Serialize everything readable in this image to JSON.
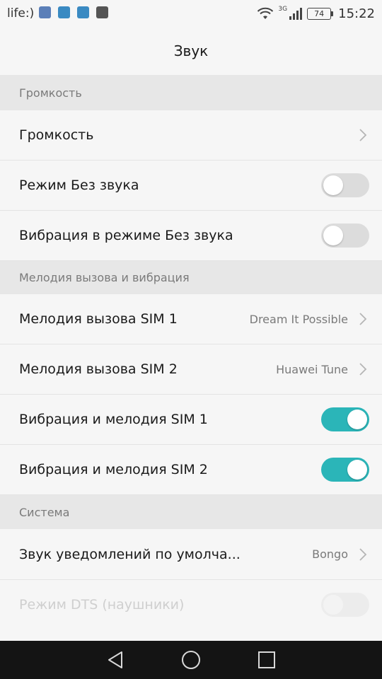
{
  "status_bar": {
    "carrier": "life:)",
    "notification_icons": [
      {
        "name": "vk-icon",
        "color": "#5b7fb8"
      },
      {
        "name": "message-icon",
        "color": "#3a8ac2"
      },
      {
        "name": "image-icon",
        "color": "#3a8ac2"
      },
      {
        "name": "gallery-icon",
        "color": "#555555"
      }
    ],
    "network_type": "3G",
    "battery": "74",
    "time": "15:22"
  },
  "header": {
    "title": "Звук"
  },
  "sections": {
    "volume": {
      "header": "Громкость",
      "rows": {
        "volume": {
          "label": "Громкость"
        },
        "silent_mode": {
          "label": "Режим Без звука",
          "enabled": false
        },
        "vibrate_in_silent": {
          "label": "Вибрация в режиме Без звука",
          "enabled": false
        }
      }
    },
    "ringtone": {
      "header": "Мелодия вызова и вибрация",
      "rows": {
        "ringtone_sim1": {
          "label": "Мелодия вызова SIM 1",
          "value": "Dream It Possible"
        },
        "ringtone_sim2": {
          "label": "Мелодия вызова SIM 2",
          "value": "Huawei Tune"
        },
        "vibrate_ring_sim1": {
          "label": "Вибрация и мелодия SIM 1",
          "enabled": true
        },
        "vibrate_ring_sim2": {
          "label": "Вибрация и мелодия SIM 2",
          "enabled": true
        }
      }
    },
    "system": {
      "header": "Система",
      "rows": {
        "notification_sound": {
          "label": "Звук уведомлений по умолча...",
          "value": "Bongo"
        },
        "dts_mode": {
          "label": "Режим DTS (наушники)",
          "enabled": false,
          "disabled": true
        }
      }
    }
  },
  "colors": {
    "accent": "#2bb5b8",
    "background": "#f6f6f6",
    "section_header_bg": "#e7e7e7",
    "nav_bar_bg": "#141414"
  }
}
